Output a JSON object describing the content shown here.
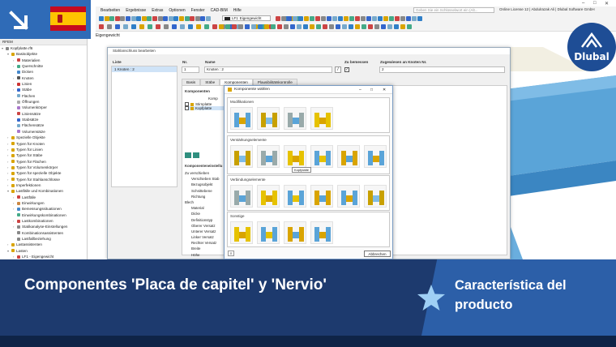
{
  "app": {
    "menu": [
      "Bearbeiten",
      "Ergebnisse",
      "Extras",
      "Optionen",
      "Fenster",
      "CAD-BIM",
      "Hilfe"
    ],
    "search_placeholder": "Geben Sie ein Schlüsselwort ein (Alt...",
    "license": "Online License 12 | Abdulrazak Ali | Dlubal Software GmbH",
    "load_case": {
      "code": "LF1",
      "name": "Eigengewicht"
    },
    "breadcrumb": "Eigengewicht"
  },
  "navigator": {
    "header": "RFEM",
    "items": [
      {
        "label": "Kopfplatte.rf6",
        "indent": 0,
        "arrow": "▾",
        "color": "#888"
      },
      {
        "label": "Basisobjekte",
        "indent": 1,
        "arrow": "▾",
        "color": "#d9a400"
      },
      {
        "label": "Materialien",
        "indent": 2,
        "arrow": "›",
        "color": "#c44"
      },
      {
        "label": "Querschnitte",
        "indent": 2,
        "arrow": "›",
        "color": "#4a8"
      },
      {
        "label": "Dicken",
        "indent": 2,
        "arrow": "",
        "color": "#48c"
      },
      {
        "label": "Knoten",
        "indent": 2,
        "arrow": "›",
        "color": "#555"
      },
      {
        "label": "Linien",
        "indent": 2,
        "arrow": "›",
        "color": "#c33"
      },
      {
        "label": "Stäbe",
        "indent": 2,
        "arrow": "›",
        "color": "#36c"
      },
      {
        "label": "Flächen",
        "indent": 2,
        "arrow": "",
        "color": "#7ac"
      },
      {
        "label": "Öffnungen",
        "indent": 2,
        "arrow": "",
        "color": "#aaa"
      },
      {
        "label": "Volumenkörper",
        "indent": 2,
        "arrow": "",
        "color": "#a7c"
      },
      {
        "label": "Liniensätze",
        "indent": 2,
        "arrow": "",
        "color": "#c44"
      },
      {
        "label": "Stabsätze",
        "indent": 2,
        "arrow": "",
        "color": "#36c"
      },
      {
        "label": "Flächensätze",
        "indent": 2,
        "arrow": "",
        "color": "#7ac"
      },
      {
        "label": "Volumensätze",
        "indent": 2,
        "arrow": "",
        "color": "#a7c"
      },
      {
        "label": "Spezielle Objekte",
        "indent": 1,
        "arrow": "›",
        "color": "#d9a400"
      },
      {
        "label": "Typen für Knoten",
        "indent": 1,
        "arrow": "›",
        "color": "#d9a400"
      },
      {
        "label": "Typen für Linien",
        "indent": 1,
        "arrow": "›",
        "color": "#d9a400"
      },
      {
        "label": "Typen für Stäbe",
        "indent": 1,
        "arrow": "›",
        "color": "#d9a400"
      },
      {
        "label": "Typen für Flächen",
        "indent": 1,
        "arrow": "›",
        "color": "#d9a400"
      },
      {
        "label": "Typen für Volumenkörper",
        "indent": 1,
        "arrow": "›",
        "color": "#d9a400"
      },
      {
        "label": "Typen für spezielle Objekte",
        "indent": 1,
        "arrow": "›",
        "color": "#d9a400"
      },
      {
        "label": "Typen für Stahlanschlüsse",
        "indent": 1,
        "arrow": "›",
        "color": "#d9a400"
      },
      {
        "label": "Imperfektionen",
        "indent": 1,
        "arrow": "›",
        "color": "#d9a400"
      },
      {
        "label": "Lastfälle und Kombinationen",
        "indent": 1,
        "arrow": "▾",
        "color": "#d9a400"
      },
      {
        "label": "Lastfälle",
        "indent": 2,
        "arrow": "›",
        "color": "#c44"
      },
      {
        "label": "Einwirkungen",
        "indent": 2,
        "arrow": "›",
        "color": "#c84"
      },
      {
        "label": "Bemessungssituationen",
        "indent": 2,
        "arrow": "›",
        "color": "#48c"
      },
      {
        "label": "Einwirkungskombinationen",
        "indent": 2,
        "arrow": "",
        "color": "#4a8"
      },
      {
        "label": "Lastkombinationen",
        "indent": 2,
        "arrow": "›",
        "color": "#c44"
      },
      {
        "label": "Statikanalyse-Einstellungen",
        "indent": 2,
        "arrow": "›",
        "color": "#888"
      },
      {
        "label": "Kombinationsassistenten",
        "indent": 2,
        "arrow": "",
        "color": "#888"
      },
      {
        "label": "Lastfallbeziehung",
        "indent": 2,
        "arrow": "",
        "color": "#888"
      },
      {
        "label": "Lastassistenten",
        "indent": 1,
        "arrow": "›",
        "color": "#d9a400"
      },
      {
        "label": "Lasten",
        "indent": 1,
        "arrow": "▾",
        "color": "#d9a400"
      },
      {
        "label": "LF1 - Eigengewicht",
        "indent": 2,
        "arrow": "›",
        "color": "#c44"
      },
      {
        "label": "Berechnungsdiagramme",
        "indent": 1,
        "arrow": "",
        "color": "#888"
      }
    ]
  },
  "dialog": {
    "title": "Stahlanschluss bearbeiten",
    "list_label": "Liste",
    "list_item": "1   Knoten : 2",
    "no_label": "Nr.",
    "no_value": "1",
    "name_label": "Name",
    "name_value": "Knoten : 2",
    "assign_label": "Zu bemessen",
    "nodes_label": "Zugewiesen an Knoten Nr.",
    "nodes_value": "2",
    "tabs": [
      "Basis",
      "Stäbe",
      "Komponenten",
      "Plausibilitätskontrolle"
    ],
    "components_label": "Komponenten",
    "components_col": "Komp",
    "components": [
      "Stirnplatte",
      "Kopfplatte"
    ],
    "settings_label": "Komponenteneinstellu",
    "settings_rows": [
      "Zu verschieben",
      "Verschieben Stab",
      "Bezugsobjekt",
      "Schnittebene",
      "Richtung",
      "Blech",
      "Material",
      "Dicke",
      "Definitionstyp",
      "Oberer Versatz",
      "Unterer Versatz",
      "Linker Versatz",
      "Rechter Versatz",
      "Breite",
      "Höhe",
      "Lage"
    ]
  },
  "subdialog": {
    "title": "Komponente wählen",
    "groups": [
      {
        "title": "Modifikationen",
        "count": 4
      },
      {
        "title": "Verstärkungselemente",
        "count": 6
      },
      {
        "title": "Verbindungselemente",
        "count": 6
      },
      {
        "title": "Sonstige",
        "count": 4
      }
    ],
    "tooltip": "Kopfplatte",
    "cancel": "Abbrechen"
  },
  "banner": {
    "title": "Componentes 'Placa de capitel' y 'Nervio'",
    "feature": "Característica del producto",
    "logo": "Dlubal",
    "flag_colors": [
      "#c60b1e",
      "#ffc400"
    ],
    "accent": "#2f6bb7"
  }
}
